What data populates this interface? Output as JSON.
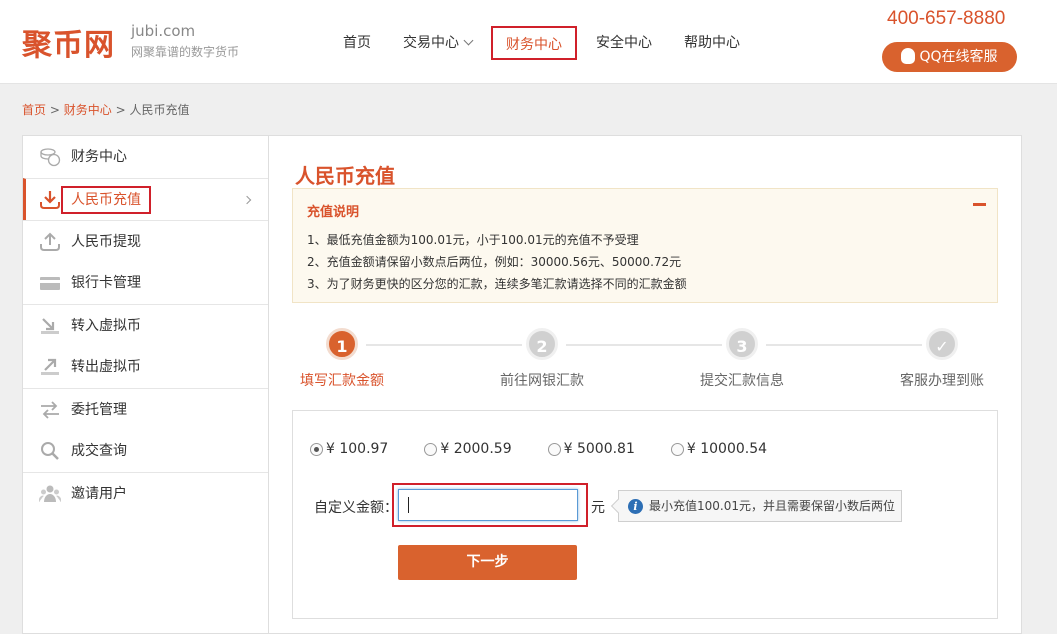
{
  "header": {
    "logo_text": "聚币网",
    "logo_domain": "jubi.com",
    "logo_slogan": "网聚靠谱的数字货币",
    "phone": "400-657-8880",
    "qq_button": "QQ在线客服",
    "nav": [
      {
        "label": "首页"
      },
      {
        "label": "交易中心"
      },
      {
        "label": "财务中心",
        "active": true
      },
      {
        "label": "安全中心"
      },
      {
        "label": "帮助中心"
      }
    ]
  },
  "breadcrumb": {
    "home": "首页",
    "sep1": ">",
    "section": "财务中心",
    "sep2": ">",
    "current": "人民币充值"
  },
  "sidebar": {
    "items": [
      {
        "label": "财务中心",
        "icon": "coins-icon"
      },
      {
        "label": "人民币充值",
        "icon": "download-icon",
        "active": true
      },
      {
        "label": "人民币提现",
        "icon": "upload-icon"
      },
      {
        "label": "银行卡管理",
        "icon": "card-icon"
      },
      {
        "label": "转入虚拟币",
        "icon": "transfer-in-icon"
      },
      {
        "label": "转出虚拟币",
        "icon": "transfer-out-icon"
      },
      {
        "label": "委托管理",
        "icon": "exchange-icon"
      },
      {
        "label": "成交查询",
        "icon": "search-icon"
      },
      {
        "label": "邀请用户",
        "icon": "users-icon"
      }
    ]
  },
  "main": {
    "title": "人民币充值",
    "notice": {
      "title": "充值说明",
      "lines": [
        "1、最低充值金额为100.01元，小于100.01元的充值不予受理",
        "2、充值金额请保留小数点后两位，例如：30000.56元、50000.72元",
        "3、为了财务更快的区分您的汇款，连续多笔汇款请选择不同的汇款金额"
      ]
    },
    "steps": [
      {
        "num": "1",
        "label": "填写汇款金额"
      },
      {
        "num": "2",
        "label": "前往网银汇款"
      },
      {
        "num": "3",
        "label": "提交汇款信息"
      },
      {
        "num": "✓",
        "label": "客服办理到账"
      }
    ],
    "form": {
      "options": [
        "¥ 100.97",
        "¥ 2000.59",
        "¥ 5000.81",
        "¥ 10000.54"
      ],
      "selected": "¥ 100.97",
      "custom_label": "自定义金额：",
      "custom_value": "",
      "unit": "元",
      "hint": "最小充值100.01元，并且需要保留小数后两位",
      "next_button": "下一步"
    }
  },
  "colors": {
    "brand": "#d9532c",
    "button": "#d9622e",
    "highlight_border": "#d0202a"
  }
}
